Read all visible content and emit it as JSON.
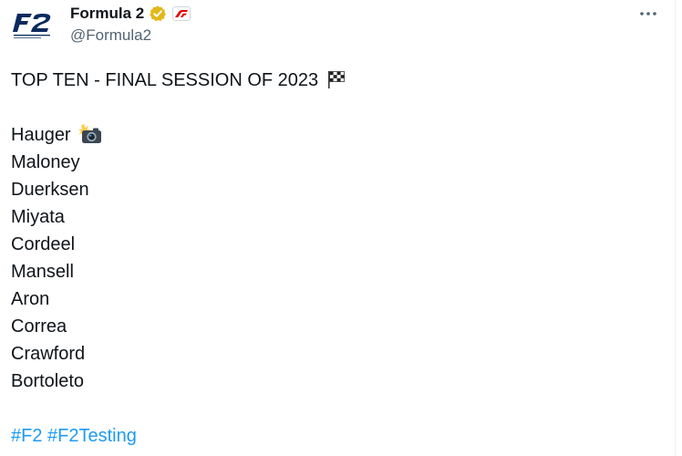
{
  "account": {
    "display_name": "Formula 2",
    "handle": "@Formula2",
    "avatar_icon": "f2-logo-icon",
    "verified_icon": "gold-verified-badge-icon",
    "affiliate_icon": "f1-affiliate-badge-icon"
  },
  "tweet": {
    "headline": "TOP TEN - FINAL SESSION OF 2023",
    "headline_emoji": "chequered-flag-icon",
    "drivers": [
      "Hauger",
      "Maloney",
      "Duerksen",
      "Miyata",
      "Cordeel",
      "Mansell",
      "Aron",
      "Correa",
      "Crawford",
      "Bortoleto"
    ],
    "first_driver_emoji": "camera-with-flash-icon",
    "hashtags": [
      "#F2",
      "#F2Testing"
    ]
  },
  "colors": {
    "text": "#0f1419",
    "secondary_text": "#536471",
    "link": "#1d9bf0",
    "f2_blue": "#0a2a5e",
    "f1_red": "#e10600",
    "verified_gold": "#e2b719"
  }
}
